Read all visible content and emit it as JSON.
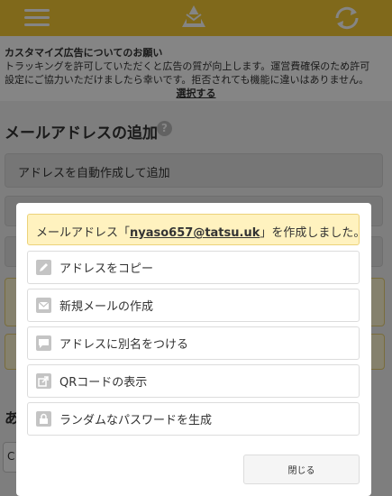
{
  "notice": {
    "title": "カスタマイズ広告についてのお願い",
    "line1": "トラッキングを許可していただくと広告の質が向上します。運営費確保のため許可",
    "line2": "設定にご協力いただけましたら幸いです。拒否されても機能に違いはありません。",
    "link": "選択する"
  },
  "section": {
    "title": "メールアドレスの追加",
    "help": "?",
    "auto_button": "アドレスを自動作成して追加"
  },
  "background": {
    "side_title": "あ",
    "side_field": "C"
  },
  "modal": {
    "success_prefix": "メールアドレス「",
    "email": "nyaso657@tatsu.uk",
    "success_suffix": "」を作成しました。",
    "actions": [
      {
        "label": "アドレスをコピー",
        "icon": "pencil-icon"
      },
      {
        "label": "新規メールの作成",
        "icon": "envelope-icon"
      },
      {
        "label": "アドレスに別名をつける",
        "icon": "speech-bubble-icon"
      },
      {
        "label": "QRコードの表示",
        "icon": "share-icon"
      },
      {
        "label": "ランダムなパスワードを生成",
        "icon": "lock-icon"
      }
    ],
    "close": "閉じる"
  },
  "colors": {
    "accent": "#f5c935",
    "success_bg": "#fff2bf",
    "icon_gray": "#c4c4c4"
  }
}
